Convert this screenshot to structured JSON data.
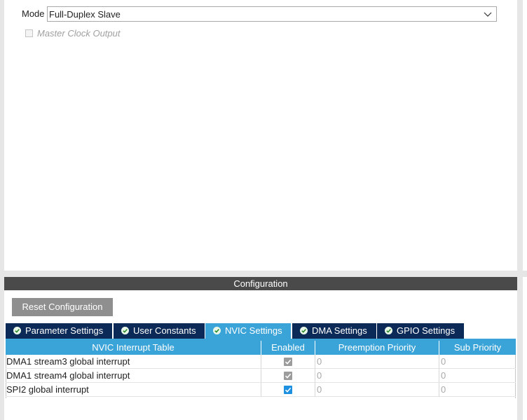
{
  "mode": {
    "label": "Mode",
    "value": "Full-Duplex Slave"
  },
  "master_clock_output": {
    "label": "Master Clock Output",
    "checked": false,
    "enabled": false
  },
  "configuration": {
    "title": "Configuration",
    "reset_button_label": "Reset Configuration"
  },
  "tabs": [
    {
      "label": "Parameter Settings",
      "active": false
    },
    {
      "label": "User Constants",
      "active": false
    },
    {
      "label": "NVIC Settings",
      "active": true
    },
    {
      "label": "DMA Settings",
      "active": false
    },
    {
      "label": "GPIO Settings",
      "active": false
    }
  ],
  "nvic_table": {
    "columns": [
      "NVIC Interrupt Table",
      "Enabled",
      "Preemption Priority",
      "Sub Priority"
    ],
    "rows": [
      {
        "name": "DMA1 stream3 global interrupt",
        "enabled": true,
        "editable": false,
        "preemption_priority": "0",
        "sub_priority": "0"
      },
      {
        "name": "DMA1 stream4 global interrupt",
        "enabled": true,
        "editable": false,
        "preemption_priority": "0",
        "sub_priority": "0"
      },
      {
        "name": "SPI2 global interrupt",
        "enabled": true,
        "editable": true,
        "preemption_priority": "0",
        "sub_priority": "0"
      }
    ]
  },
  "colors": {
    "tab_inactive": "#0b2a57",
    "tab_active": "#3aa3d8",
    "header_bar": "#4a4a4a",
    "reset_button": "#8f8f8f",
    "check_editable": "#1e90e0",
    "check_locked": "#9c9c9c"
  }
}
